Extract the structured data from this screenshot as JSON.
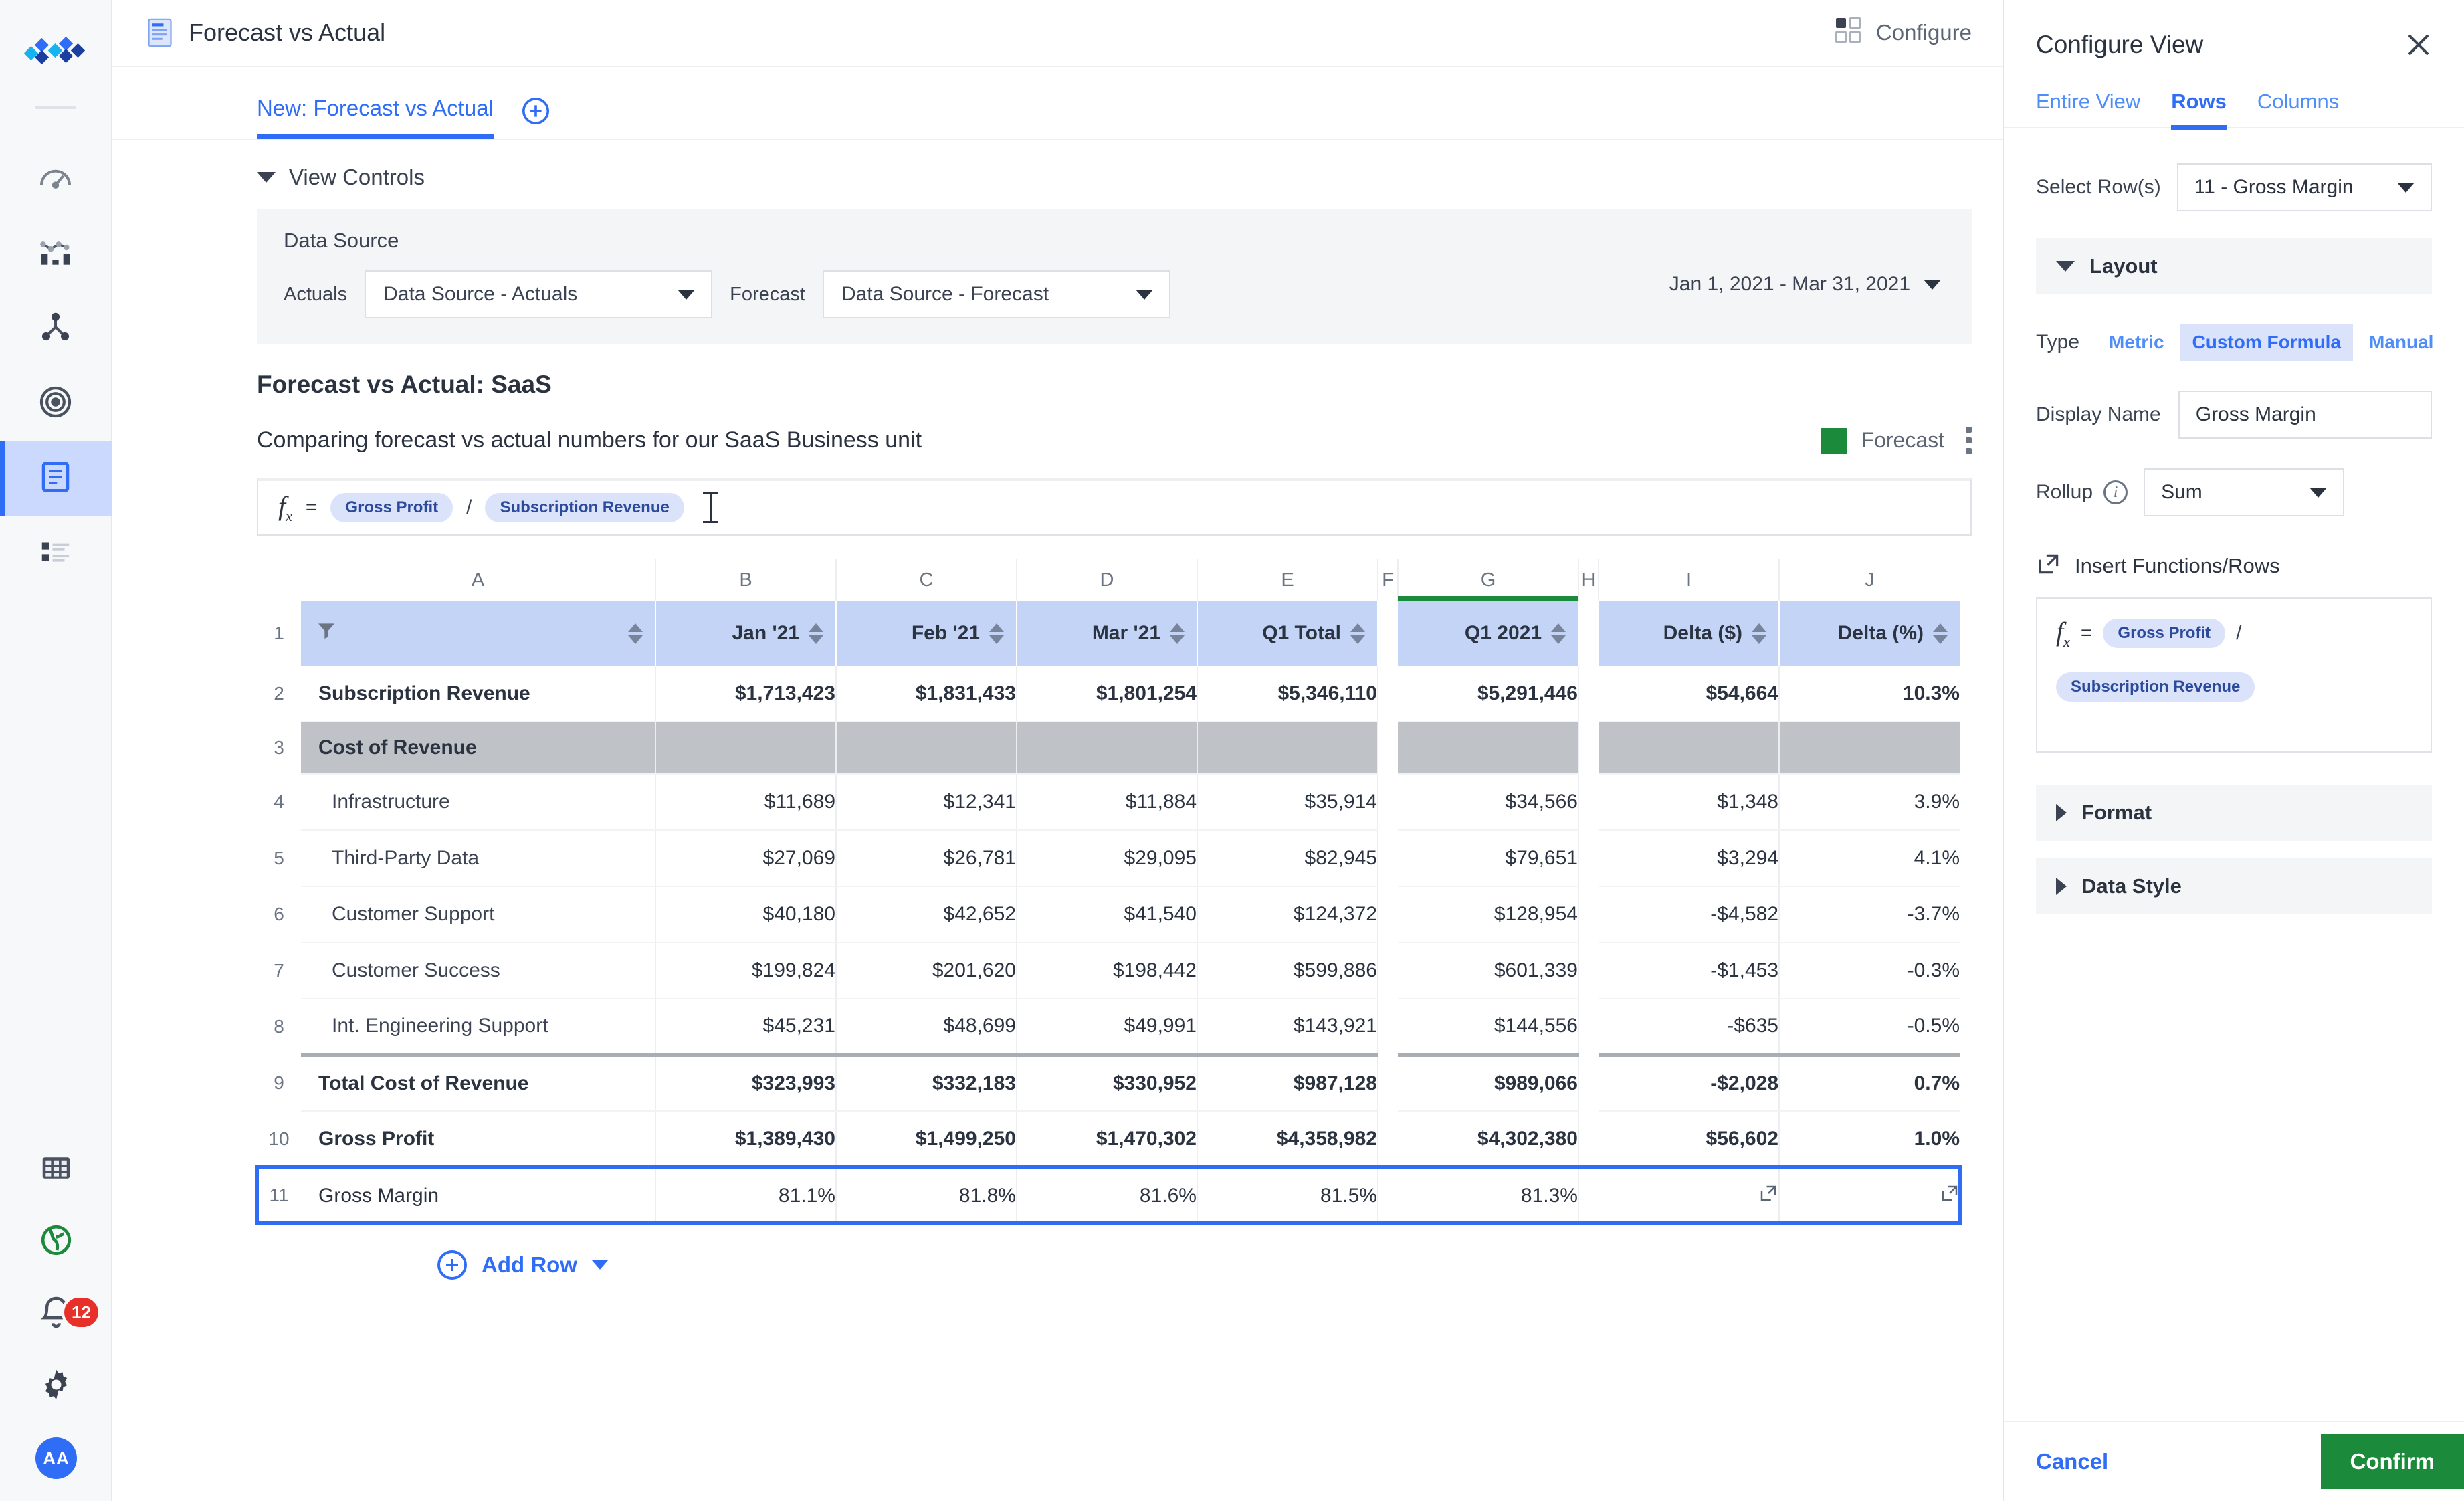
{
  "rail": {
    "logo_icon": "trimond-logo-icon",
    "items": [
      {
        "icon": "gauge-icon",
        "name": "dashboard"
      },
      {
        "icon": "analytics-bar-line-icon",
        "name": "analytics"
      },
      {
        "icon": "workflow-node-icon",
        "name": "workflow"
      },
      {
        "icon": "target-icon",
        "name": "targets"
      },
      {
        "icon": "report-document-icon",
        "name": "reports",
        "active": true
      },
      {
        "icon": "list-items-icon",
        "name": "lists"
      }
    ],
    "bottom_items": [
      {
        "icon": "grid-table-icon",
        "name": "data-grid"
      },
      {
        "icon": "globe-icon",
        "name": "globe"
      },
      {
        "icon": "bell-icon",
        "name": "notifications",
        "badge": "12"
      },
      {
        "icon": "gear-icon",
        "name": "settings"
      },
      {
        "icon": "avatar",
        "name": "user-avatar",
        "initials": "AA"
      }
    ]
  },
  "topbar": {
    "doc_icon": "document-icon",
    "title": "Forecast vs Actual",
    "configure_icon": "grid-squares-icon",
    "configure_label": "Configure"
  },
  "tabs": {
    "items": [
      {
        "label": "New: Forecast vs Actual",
        "active": true
      }
    ],
    "add_icon": "plus-circle-icon"
  },
  "view_controls": {
    "chevron_icon": "chevron-down-icon",
    "label": "View Controls",
    "data_source_title": "Data Source",
    "actuals_label": "Actuals",
    "actuals_value": "Data Source - Actuals",
    "forecast_label": "Forecast",
    "forecast_value": "Data Source - Forecast",
    "date_range": "Jan 1, 2021 - Mar 31, 2021",
    "date_caret_icon": "caret-down-icon"
  },
  "report": {
    "title": "Forecast vs Actual: SaaS",
    "subtitle": "Comparing forecast vs actual numbers for our SaaS Business unit",
    "legend_label": "Forecast",
    "legend_color": "#1b8a3a",
    "kebab_icon": "more-vertical-icon"
  },
  "formula_bar": {
    "fx_icon": "fx-icon",
    "equals": "=",
    "chips": [
      "Gross Profit",
      "Subscription Revenue"
    ],
    "operator": "/",
    "cursor_icon": "text-cursor-icon"
  },
  "sheet": {
    "column_letters": [
      "A",
      "B",
      "C",
      "D",
      "E",
      "F",
      "G",
      "H",
      "I",
      "J"
    ],
    "headers": {
      "a_filter_icon": "filter-icon",
      "a_label": "",
      "b": "Jan '21",
      "c": "Feb '21",
      "d": "Mar '21",
      "e": "Q1 Total",
      "g": "Q1 2021",
      "i": "Delta ($)",
      "j": "Delta (%)"
    },
    "rows": [
      {
        "n": "2",
        "label": "Subscription Revenue",
        "style": "bold",
        "values": [
          "$1,713,423",
          "$1,831,433",
          "$1,801,254",
          "$5,346,110",
          "$5,291,446",
          "$54,664",
          "10.3%"
        ]
      },
      {
        "n": "3",
        "label": "Cost of Revenue",
        "style": "section",
        "values": [
          "",
          "",
          "",
          "",
          "",
          "",
          ""
        ]
      },
      {
        "n": "4",
        "label": "Infrastructure",
        "style": "indent",
        "values": [
          "$11,689",
          "$12,341",
          "$11,884",
          "$35,914",
          "$34,566",
          "$1,348",
          "3.9%"
        ]
      },
      {
        "n": "5",
        "label": "Third-Party Data",
        "style": "indent",
        "values": [
          "$27,069",
          "$26,781",
          "$29,095",
          "$82,945",
          "$79,651",
          "$3,294",
          "4.1%"
        ]
      },
      {
        "n": "6",
        "label": "Customer Support",
        "style": "indent",
        "values": [
          "$40,180",
          "$42,652",
          "$41,540",
          "$124,372",
          "$128,954",
          "-$4,582",
          "-3.7%"
        ]
      },
      {
        "n": "7",
        "label": "Customer Success",
        "style": "indent",
        "values": [
          "$199,824",
          "$201,620",
          "$198,442",
          "$599,886",
          "$601,339",
          "-$1,453",
          "-0.3%"
        ]
      },
      {
        "n": "8",
        "label": "Int. Engineering Support",
        "style": "indent",
        "values": [
          "$45,231",
          "$48,699",
          "$49,991",
          "$143,921",
          "$144,556",
          "-$635",
          "-0.5%"
        ]
      },
      {
        "n": "9",
        "label": "Total Cost of Revenue",
        "style": "bold topline",
        "values": [
          "$323,993",
          "$332,183",
          "$330,952",
          "$987,128",
          "$989,066",
          "-$2,028",
          "0.7%"
        ]
      },
      {
        "n": "10",
        "label": "Gross Profit",
        "style": "bold",
        "values": [
          "$1,389,430",
          "$1,499,250",
          "$1,470,302",
          "$4,358,982",
          "$4,302,380",
          "$56,602",
          "1.0%"
        ]
      },
      {
        "n": "11",
        "label": "Gross Margin",
        "style": "selected",
        "values": [
          "81.1%",
          "81.8%",
          "81.6%",
          "81.5%",
          "81.3%",
          "expand",
          "expand"
        ]
      }
    ],
    "add_row_label": "Add Row",
    "add_row_icon": "plus-circle-icon",
    "add_row_caret_icon": "caret-down-icon"
  },
  "panel": {
    "title": "Configure View",
    "close_icon": "close-icon",
    "tabs": [
      {
        "label": "Entire View",
        "active": false
      },
      {
        "label": "Rows",
        "active": true
      },
      {
        "label": "Columns",
        "active": false
      }
    ],
    "select_rows_label": "Select Row(s)",
    "select_rows_value": "11 - Gross Margin",
    "layout_label": "Layout",
    "type_label": "Type",
    "type_options": [
      {
        "label": "Metric",
        "active": false
      },
      {
        "label": "Custom Formula",
        "active": true
      },
      {
        "label": "Manual",
        "active": false
      }
    ],
    "display_name_label": "Display Name",
    "display_name_value": "Gross Margin",
    "rollup_label": "Rollup",
    "rollup_info_icon": "info-icon",
    "rollup_value": "Sum",
    "insert_functions_label": "Insert Functions/Rows",
    "insert_functions_icon": "external-link-icon",
    "formula": {
      "fx_icon": "fx-icon",
      "equals": "=",
      "chips": [
        "Gross Profit",
        "Subscription Revenue"
      ],
      "operator": "/"
    },
    "sections": [
      {
        "label": "Format",
        "icon": "chevron-right-icon"
      },
      {
        "label": "Data Style",
        "icon": "chevron-right-icon"
      }
    ],
    "cancel_label": "Cancel",
    "confirm_label": "Confirm"
  }
}
